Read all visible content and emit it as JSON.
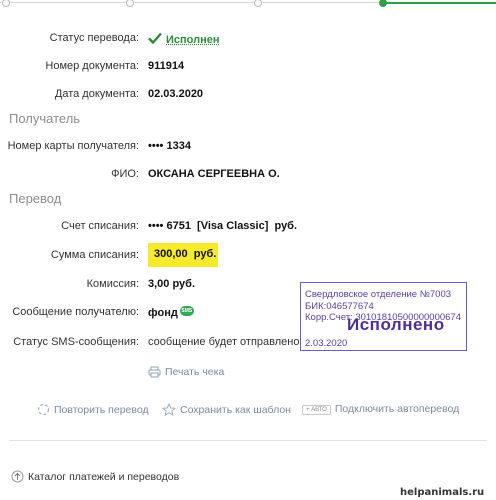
{
  "rows": {
    "status": {
      "label": "Статус перевода:",
      "value": "Исполнен"
    },
    "doc_number": {
      "label": "Номер документа:",
      "value": "911914"
    },
    "doc_date": {
      "label": "Дата документа:",
      "value": "02.03.2020"
    },
    "card_number": {
      "label": "Номер карты получателя:",
      "value": "•••• 1334"
    },
    "fio": {
      "label": "ФИО:",
      "value": "ОКСАНА СЕРГЕЕВНА О."
    },
    "account": {
      "label": "Счет списания:",
      "value": "•••• 6751  [Visa Classic]  руб."
    },
    "amount": {
      "label": "Сумма списания:",
      "value": "300,00  руб."
    },
    "commission": {
      "label": "Комиссия:",
      "value": "3,00 руб."
    },
    "message": {
      "label": "Сообщение получателю:",
      "value": "фонд",
      "badge": "SMS"
    },
    "sms_status": {
      "label": "Статус SMS-сообщения:",
      "value": "сообщение будет отправлено"
    }
  },
  "sections": {
    "recipient": "Получатель",
    "transfer": "Перевод"
  },
  "stamp": {
    "line1": "Свердловское отделение №7003",
    "line2": "БИК:046577674",
    "line3": "Корр.Счет: 30101810500000000674",
    "status": "Исполнено",
    "date": "2.03.2020"
  },
  "actions": {
    "print": "Печать чека",
    "repeat": "Повторить перевод",
    "save_template": "Сохранить как шаблон",
    "auto_badge": "+ АВТО",
    "autotransfer": "Подключить автоперевод",
    "catalog": "Каталог платежей и переводов"
  },
  "watermark": "helpanimals.ru",
  "colors": {
    "success": "#2d8a3a",
    "highlight": "#f6ea2c",
    "stamp": "#5b3ea6",
    "link": "#7a8aa5",
    "progress": "#2ea043"
  }
}
